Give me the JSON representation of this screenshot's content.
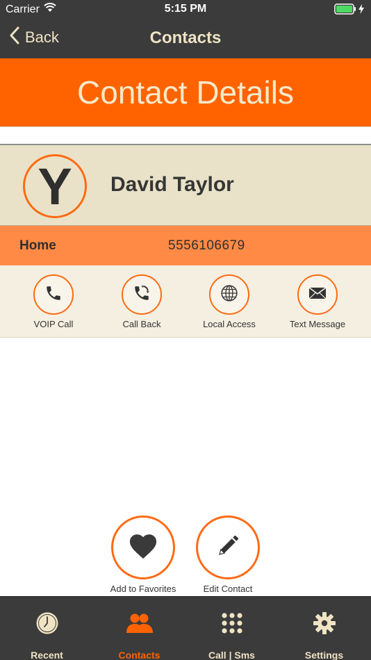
{
  "status_bar": {
    "carrier": "Carrier",
    "time": "5:15 PM",
    "icons": [
      "wifi-icon",
      "battery-icon",
      "charging-icon"
    ]
  },
  "nav": {
    "back_label": "Back",
    "title": "Contacts"
  },
  "banner": {
    "title": "Contact Details"
  },
  "contact": {
    "avatar_letter": "Y",
    "name": "David Taylor"
  },
  "phone": {
    "label": "Home",
    "number": "5556106679"
  },
  "actions": [
    {
      "label": "VOIP Call",
      "icon": "phone-icon"
    },
    {
      "label": "Call Back",
      "icon": "call-back-icon"
    },
    {
      "label": "Local Access",
      "icon": "globe-icon"
    },
    {
      "label": "Text Message",
      "icon": "envelope-icon"
    }
  ],
  "bottom_actions": [
    {
      "label": "Add to Favorites",
      "icon": "heart-icon"
    },
    {
      "label": "Edit Contact",
      "icon": "pencil-icon"
    }
  ],
  "tabs": [
    {
      "label": "Recent",
      "icon": "clock-icon",
      "active": false
    },
    {
      "label": "Contacts",
      "icon": "people-icon",
      "active": true
    },
    {
      "label": "Call | Sms",
      "icon": "keypad-icon",
      "active": false
    },
    {
      "label": "Settings",
      "icon": "gear-icon",
      "active": false
    }
  ],
  "colors": {
    "accent": "#ff6300",
    "accent_light": "#ff8a45",
    "bar_dark": "#3b3b3b",
    "cream": "#e9e2c8",
    "text_cream": "#efe3c4",
    "battery": "#4cd964"
  }
}
